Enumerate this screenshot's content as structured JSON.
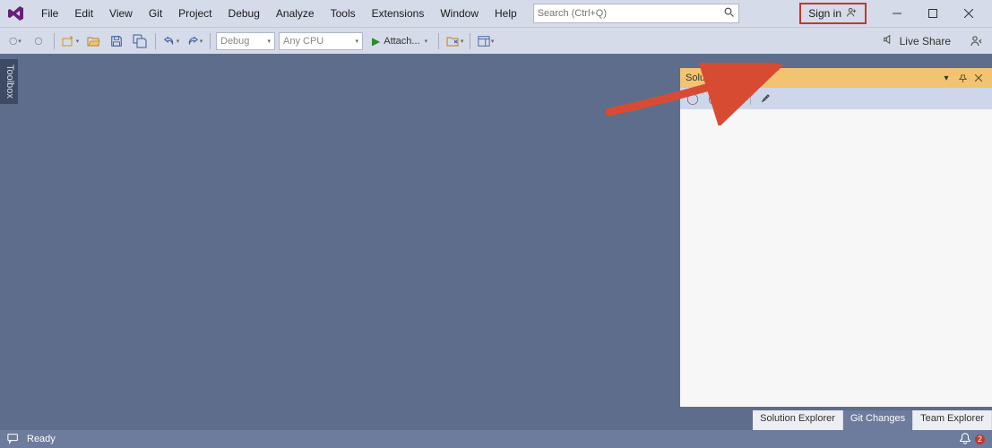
{
  "menubar": {
    "items": [
      "File",
      "Edit",
      "View",
      "Git",
      "Project",
      "Debug",
      "Analyze",
      "Tools",
      "Extensions",
      "Window",
      "Help"
    ],
    "search_placeholder": "Search (Ctrl+Q)",
    "signin": "Sign in"
  },
  "toolbar": {
    "config": "Debug",
    "platform": "Any CPU",
    "start": "Attach...",
    "liveshare": "Live Share"
  },
  "sidebar": {
    "toolbox": "Toolbox"
  },
  "solution_explorer": {
    "title": "Solution Explorer"
  },
  "bottom_tabs": [
    "Solution Explorer",
    "Git Changes",
    "Team Explorer"
  ],
  "statusbar": {
    "status": "Ready",
    "notification_count": "2"
  },
  "colors": {
    "highlight_border": "#c0392b",
    "accent": "#68217a"
  }
}
